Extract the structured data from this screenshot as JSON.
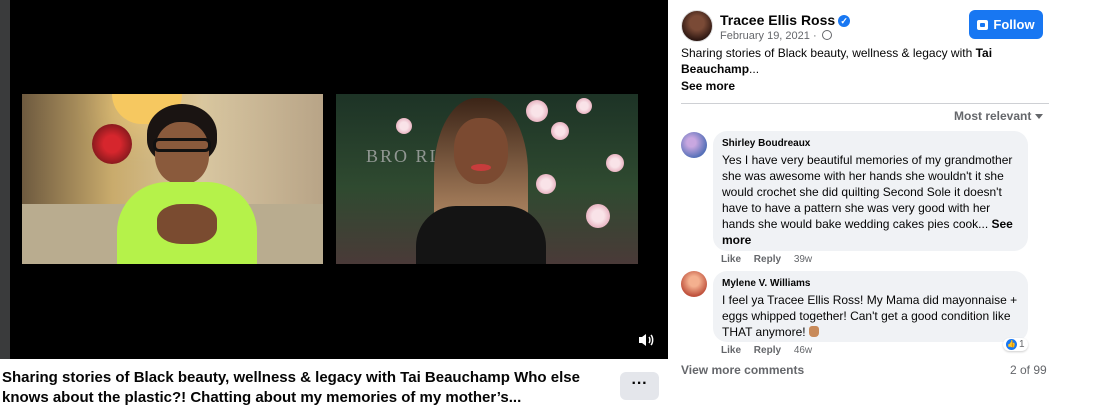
{
  "post": {
    "author": "Tracee Ellis Ross",
    "date": "February 19, 2021 ·",
    "follow_label": "Follow",
    "text_plain": "Sharing stories of Black beauty, wellness & legacy with ",
    "text_bold": "Tai Beauchamp",
    "text_ellipsis": "...",
    "see_more": "See more",
    "caption": "Sharing stories of Black beauty, wellness & legacy with Tai Beauchamp Who else knows about the plastic?! Chatting about my memories of my mother’s...",
    "more_label": "···"
  },
  "video": {
    "banner_text": "BRO     RL xxne"
  },
  "comments_header": {
    "sort_label": "Most relevant"
  },
  "comments": [
    {
      "name": "Shirley Boudreaux",
      "text": "Yes I have very beautiful memories of my grandmother she was awesome with her hands she wouldn't it she would crochet she did quilting Second Sole it doesn't have to have a pattern she was very good with her hands she would bake wedding cakes pies cook...",
      "see_more": " See more",
      "like": "Like",
      "reply": "Reply",
      "time": "39w"
    },
    {
      "name": "Mylene V. Williams",
      "text": "I feel ya Tracee Ellis Ross! My Mama did mayonnaise + eggs whipped together! Can't get a good condition like THAT anymore!",
      "like": "Like",
      "reply": "Reply",
      "time": "46w",
      "reaction_count": "1"
    }
  ],
  "footer": {
    "view_more": "View more comments",
    "count": "2 of 99"
  },
  "icons": {
    "verified": "verified-badge-icon",
    "globe": "globe-icon",
    "follow": "follow-page-icon",
    "volume": "volume-icon",
    "caret": "caret-down-icon",
    "like": "like-reaction-icon"
  },
  "colors": {
    "accent": "#1877f2",
    "bubble": "#f0f2f5",
    "muted_text": "#65676b",
    "video_bg": "#000000"
  }
}
